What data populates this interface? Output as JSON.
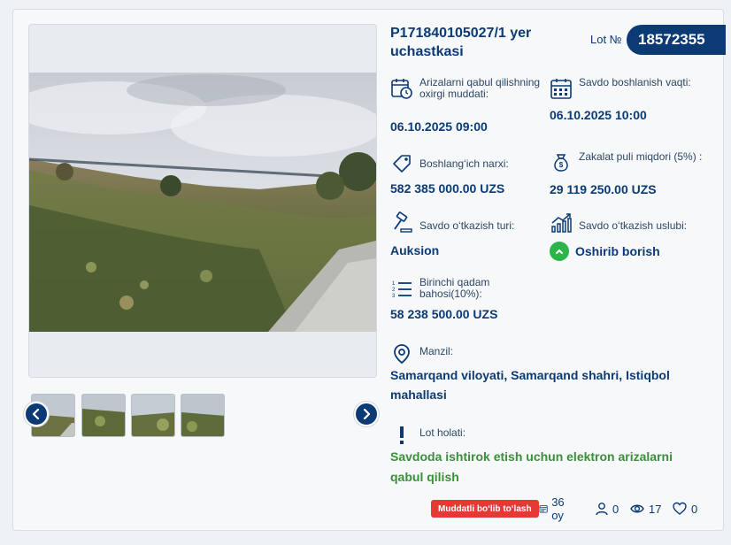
{
  "lot": {
    "title": "P171840105027/1 yer uchastkasi",
    "number_label": "Lot №",
    "number": "18572355"
  },
  "fields": {
    "application_deadline": {
      "label": "Arizalarni qabul qilishning oxirgi muddati:",
      "value": "06.10.2025 09:00",
      "icon": "calendar-clock-icon"
    },
    "auction_start": {
      "label": "Savdo boshlanish vaqti:",
      "value": "06.10.2025 10:00",
      "icon": "calendar-grid-icon"
    },
    "start_price": {
      "label": "Boshlang‘ich narxi:",
      "value": "582 385 000.00 UZS",
      "icon": "price-tag-icon"
    },
    "deposit": {
      "label": "Zakalat puli miqdori (5%) :",
      "value": "29 119 250.00 UZS",
      "icon": "money-bag-icon"
    },
    "auction_type": {
      "label": "Savdo o‘tkazish turi:",
      "value": "Auksion",
      "icon": "gavel-icon"
    },
    "auction_method": {
      "label": "Savdo o‘tkazish uslubi:",
      "value": "Oshirib borish",
      "icon": "rising-chart-icon",
      "badge_icon": "chevron-up-icon",
      "badge_color": "#2db54a"
    },
    "first_step": {
      "label": "Birinchi qadam bahosi(10%):",
      "value": "58 238 500.00 UZS",
      "icon": "list-icon"
    },
    "address": {
      "label": "Manzil:",
      "value": "Samarqand viloyati, Samarqand shahri, Istiqbol mahallasi",
      "icon": "location-pin-icon"
    },
    "status": {
      "label": "Lot holati:",
      "value": "Savdoda ishtirok etish uchun elektron arizalarni qabul qilish",
      "icon": "exclamation-icon",
      "color": "#3a8f3a"
    }
  },
  "footer": {
    "installment_label": "Muddatli bo‘lib to‘lash",
    "installment_color": "#e53935",
    "months": "36 oy",
    "participants": "0",
    "views": "17",
    "favorites": "0"
  },
  "gallery": {
    "thumbnail_count": 4,
    "prev_icon": "chevron-left-icon",
    "next_icon": "chevron-right-icon"
  },
  "colors": {
    "primary": "#0b3a75",
    "success": "#2db54a"
  }
}
